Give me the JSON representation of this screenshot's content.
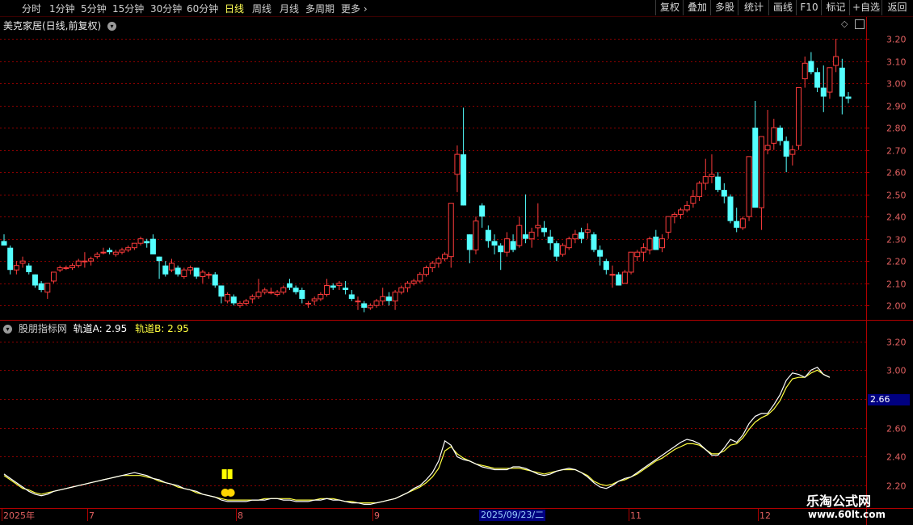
{
  "toolbar": {
    "periods": [
      "分时",
      "1分钟",
      "5分钟",
      "15分钟",
      "30分钟",
      "60分钟",
      "日线",
      "周线",
      "月线",
      "多周期",
      "更多"
    ],
    "active_period": "日线",
    "right_buttons": [
      "复权",
      "叠加",
      "多股",
      "统计",
      "画线",
      "F10",
      "标记",
      "+自选",
      "返回"
    ]
  },
  "main_panel": {
    "title": "美克家居(日线,前复权)",
    "icons": [
      "chevron-down-icon",
      "diamond-icon",
      "panel-toggle-icon"
    ]
  },
  "indicator_panel": {
    "title": "股朋指标网",
    "line_a_label": "轨道A",
    "line_a_value": "2.95",
    "line_b_label": "轨道B",
    "line_b_value": "2.95",
    "colors": {
      "line_a": "#ffffff",
      "line_b": "#ffff40"
    }
  },
  "price_axis": [
    "3.20",
    "3.10",
    "3.00",
    "2.90",
    "2.80",
    "2.70",
    "2.60",
    "2.50",
    "2.40",
    "2.30",
    "2.20",
    "2.10",
    "2.00"
  ],
  "indicator_axis": [
    "3.20",
    "3.00",
    "2.80",
    "2.60",
    "2.40",
    "2.20"
  ],
  "crosshair_price": "2.66",
  "date_axis": [
    "2025年",
    "7",
    "8",
    "9",
    "2025/09/23/二",
    "11",
    "12"
  ],
  "watermark": {
    "line1": "乐淘公式网",
    "line2": "www.60lt.com"
  },
  "colors": {
    "up": "#ff3c3c",
    "down": "#54ffff",
    "grid": "#8b0000",
    "axis_text": "#e06060"
  },
  "chart_data": {
    "type": "candlestick",
    "ylim": [
      1.95,
      3.24
    ],
    "indicator_ylim": [
      2.05,
      3.27
    ],
    "candles": [
      [
        2.29,
        2.32,
        2.27,
        2.27
      ],
      [
        2.26,
        2.27,
        2.14,
        2.16
      ],
      [
        2.16,
        2.2,
        2.14,
        2.18
      ],
      [
        2.19,
        2.22,
        2.17,
        2.2
      ],
      [
        2.18,
        2.19,
        2.14,
        2.15
      ],
      [
        2.14,
        2.14,
        2.08,
        2.09
      ],
      [
        2.1,
        2.11,
        2.06,
        2.07
      ],
      [
        2.06,
        2.1,
        2.03,
        2.1
      ],
      [
        2.11,
        2.15,
        2.1,
        2.15
      ],
      [
        2.16,
        2.18,
        2.15,
        2.17
      ],
      [
        2.17,
        2.18,
        2.16,
        2.17
      ],
      [
        2.17,
        2.19,
        2.16,
        2.18
      ],
      [
        2.18,
        2.21,
        2.17,
        2.2
      ],
      [
        2.2,
        2.24,
        2.17,
        2.2
      ],
      [
        2.2,
        2.22,
        2.18,
        2.21
      ],
      [
        2.22,
        2.24,
        2.21,
        2.23
      ],
      [
        2.24,
        2.26,
        2.23,
        2.24
      ],
      [
        2.25,
        2.26,
        2.23,
        2.24
      ],
      [
        2.23,
        2.25,
        2.22,
        2.24
      ],
      [
        2.24,
        2.26,
        2.23,
        2.25
      ],
      [
        2.25,
        2.27,
        2.24,
        2.26
      ],
      [
        2.26,
        2.28,
        2.25,
        2.28
      ],
      [
        2.28,
        2.31,
        2.27,
        2.3
      ],
      [
        2.29,
        2.3,
        2.26,
        2.28
      ],
      [
        2.3,
        2.32,
        2.24,
        2.23
      ],
      [
        2.22,
        2.22,
        2.12,
        2.2
      ],
      [
        2.18,
        2.2,
        2.13,
        2.14
      ],
      [
        2.16,
        2.21,
        2.15,
        2.19
      ],
      [
        2.17,
        2.18,
        2.13,
        2.14
      ],
      [
        2.13,
        2.17,
        2.12,
        2.16
      ],
      [
        2.16,
        2.18,
        2.14,
        2.17
      ],
      [
        2.17,
        2.17,
        2.12,
        2.13
      ],
      [
        2.13,
        2.16,
        2.1,
        2.15
      ],
      [
        2.14,
        2.15,
        2.12,
        2.14
      ],
      [
        2.14,
        2.15,
        2.08,
        2.09
      ],
      [
        2.09,
        2.09,
        2.01,
        2.04
      ],
      [
        2.02,
        2.06,
        2.01,
        2.05
      ],
      [
        2.04,
        2.05,
        2.0,
        2.01
      ],
      [
        2.0,
        2.02,
        1.99,
        2.01
      ],
      [
        2.01,
        2.03,
        2.0,
        2.02
      ],
      [
        2.03,
        2.05,
        2.01,
        2.04
      ],
      [
        2.04,
        2.12,
        2.03,
        2.06
      ],
      [
        2.06,
        2.08,
        2.05,
        2.07
      ],
      [
        2.06,
        2.08,
        2.05,
        2.06
      ],
      [
        2.05,
        2.07,
        2.04,
        2.06
      ],
      [
        2.06,
        2.09,
        2.05,
        2.08
      ],
      [
        2.1,
        2.12,
        2.07,
        2.08
      ],
      [
        2.08,
        2.09,
        2.05,
        2.06
      ],
      [
        2.07,
        2.08,
        2.01,
        2.03
      ],
      [
        2.01,
        2.02,
        1.99,
        2.01
      ],
      [
        2.02,
        2.04,
        2.0,
        2.03
      ],
      [
        2.03,
        2.06,
        2.02,
        2.05
      ],
      [
        2.05,
        2.12,
        2.04,
        2.09
      ],
      [
        2.09,
        2.1,
        2.07,
        2.08
      ],
      [
        2.09,
        2.11,
        2.07,
        2.1
      ],
      [
        2.08,
        2.11,
        2.05,
        2.07
      ],
      [
        2.05,
        2.07,
        2.02,
        2.03
      ],
      [
        2.02,
        2.04,
        1.98,
        2.02
      ],
      [
        2.01,
        2.02,
        1.97,
        1.99
      ],
      [
        1.99,
        2.01,
        1.98,
        2.0
      ],
      [
        2.0,
        2.03,
        1.99,
        2.02
      ],
      [
        2.02,
        2.08,
        2.0,
        2.04
      ],
      [
        2.04,
        2.06,
        2.0,
        2.02
      ],
      [
        2.02,
        2.07,
        1.98,
        2.06
      ],
      [
        2.06,
        2.09,
        2.05,
        2.08
      ],
      [
        2.08,
        2.11,
        2.06,
        2.1
      ],
      [
        2.1,
        2.12,
        2.09,
        2.11
      ],
      [
        2.11,
        2.15,
        2.1,
        2.14
      ],
      [
        2.14,
        2.18,
        2.13,
        2.17
      ],
      [
        2.17,
        2.2,
        2.15,
        2.19
      ],
      [
        2.19,
        2.22,
        2.17,
        2.21
      ],
      [
        2.21,
        2.24,
        2.2,
        2.23
      ],
      [
        2.22,
        2.46,
        2.17,
        2.46
      ],
      [
        2.59,
        2.72,
        2.51,
        2.68
      ],
      [
        2.68,
        2.89,
        2.45,
        2.45
      ],
      [
        2.32,
        2.32,
        2.19,
        2.25
      ],
      [
        2.25,
        2.4,
        2.23,
        2.38
      ],
      [
        2.45,
        2.46,
        2.35,
        2.4
      ],
      [
        2.34,
        2.36,
        2.26,
        2.29
      ],
      [
        2.29,
        2.32,
        2.23,
        2.27
      ],
      [
        2.27,
        2.28,
        2.16,
        2.24
      ],
      [
        2.24,
        2.33,
        2.22,
        2.3
      ],
      [
        2.29,
        2.32,
        2.24,
        2.25
      ],
      [
        2.27,
        2.4,
        2.26,
        2.36
      ],
      [
        2.32,
        2.5,
        2.28,
        2.3
      ],
      [
        2.3,
        2.35,
        2.26,
        2.33
      ],
      [
        2.35,
        2.46,
        2.31,
        2.36
      ],
      [
        2.35,
        2.38,
        2.31,
        2.33
      ],
      [
        2.31,
        2.34,
        2.25,
        2.28
      ],
      [
        2.28,
        2.29,
        2.2,
        2.22
      ],
      [
        2.23,
        2.28,
        2.22,
        2.27
      ],
      [
        2.26,
        2.31,
        2.25,
        2.3
      ],
      [
        2.3,
        2.34,
        2.28,
        2.32
      ],
      [
        2.33,
        2.35,
        2.28,
        2.3
      ],
      [
        2.33,
        2.37,
        2.3,
        2.34
      ],
      [
        2.32,
        2.33,
        2.24,
        2.25
      ],
      [
        2.25,
        2.27,
        2.18,
        2.22
      ],
      [
        2.2,
        2.21,
        2.14,
        2.16
      ],
      [
        2.14,
        2.18,
        2.08,
        2.14
      ],
      [
        2.14,
        2.15,
        2.09,
        2.09
      ],
      [
        2.1,
        2.16,
        2.1,
        2.15
      ],
      [
        2.15,
        2.24,
        2.14,
        2.24
      ],
      [
        2.22,
        2.25,
        2.2,
        2.24
      ],
      [
        2.24,
        2.28,
        2.2,
        2.26
      ],
      [
        2.25,
        2.31,
        2.23,
        2.3
      ],
      [
        2.31,
        2.34,
        2.25,
        2.25
      ],
      [
        2.26,
        2.32,
        2.24,
        2.3
      ],
      [
        2.33,
        2.4,
        2.3,
        2.4
      ],
      [
        2.4,
        2.42,
        2.37,
        2.41
      ],
      [
        2.41,
        2.44,
        2.39,
        2.43
      ],
      [
        2.43,
        2.47,
        2.42,
        2.45
      ],
      [
        2.46,
        2.52,
        2.44,
        2.49
      ],
      [
        2.49,
        2.56,
        2.47,
        2.55
      ],
      [
        2.55,
        2.66,
        2.52,
        2.58
      ],
      [
        2.58,
        2.68,
        2.55,
        2.59
      ],
      [
        2.58,
        2.6,
        2.51,
        2.52
      ],
      [
        2.52,
        2.55,
        2.46,
        2.49
      ],
      [
        2.49,
        2.5,
        2.37,
        2.38
      ],
      [
        2.38,
        2.44,
        2.33,
        2.35
      ],
      [
        2.35,
        2.4,
        2.34,
        2.39
      ],
      [
        2.4,
        2.67,
        2.38,
        2.67
      ],
      [
        2.8,
        2.92,
        2.44,
        2.44
      ],
      [
        2.44,
        2.76,
        2.34,
        2.76
      ],
      [
        2.7,
        2.88,
        2.68,
        2.72
      ],
      [
        2.73,
        2.84,
        2.7,
        2.8
      ],
      [
        2.8,
        2.81,
        2.72,
        2.74
      ],
      [
        2.74,
        2.76,
        2.6,
        2.67
      ],
      [
        2.68,
        2.72,
        2.63,
        2.7
      ],
      [
        2.72,
        2.9,
        2.7,
        2.98
      ],
      [
        3.02,
        3.12,
        2.98,
        3.09
      ],
      [
        3.1,
        3.14,
        3.04,
        3.05
      ],
      [
        3.05,
        3.07,
        2.96,
        2.98
      ],
      [
        2.98,
        3.08,
        2.87,
        2.94
      ],
      [
        2.96,
        3.04,
        2.93,
        3.07
      ],
      [
        3.08,
        3.2,
        3.05,
        3.12
      ],
      [
        3.07,
        3.11,
        2.86,
        2.94
      ],
      [
        2.94,
        2.96,
        2.91,
        2.93
      ]
    ],
    "rail_a": [
      2.28,
      2.25,
      2.22,
      2.19,
      2.16,
      2.14,
      2.13,
      2.14,
      2.16,
      2.17,
      2.18,
      2.19,
      2.2,
      2.21,
      2.22,
      2.23,
      2.24,
      2.25,
      2.26,
      2.27,
      2.28,
      2.29,
      2.28,
      2.27,
      2.25,
      2.24,
      2.22,
      2.21,
      2.2,
      2.18,
      2.17,
      2.16,
      2.14,
      2.13,
      2.12,
      2.1,
      2.09,
      2.09,
      2.09,
      2.09,
      2.1,
      2.1,
      2.1,
      2.11,
      2.11,
      2.1,
      2.1,
      2.09,
      2.09,
      2.09,
      2.1,
      2.1,
      2.11,
      2.1,
      2.1,
      2.09,
      2.08,
      2.08,
      2.07,
      2.07,
      2.08,
      2.09,
      2.1,
      2.11,
      2.13,
      2.15,
      2.18,
      2.2,
      2.24,
      2.29,
      2.37,
      2.51,
      2.48,
      2.4,
      2.38,
      2.37,
      2.35,
      2.33,
      2.32,
      2.31,
      2.31,
      2.31,
      2.33,
      2.33,
      2.32,
      2.3,
      2.28,
      2.27,
      2.28,
      2.3,
      2.31,
      2.32,
      2.31,
      2.29,
      2.26,
      2.22,
      2.19,
      2.18,
      2.2,
      2.23,
      2.25,
      2.26,
      2.29,
      2.32,
      2.35,
      2.38,
      2.41,
      2.44,
      2.47,
      2.5,
      2.52,
      2.51,
      2.49,
      2.45,
      2.41,
      2.41,
      2.46,
      2.52,
      2.5,
      2.55,
      2.63,
      2.68,
      2.7,
      2.7,
      2.76,
      2.83,
      2.93,
      2.98,
      2.97,
      2.95,
      3.0,
      3.02,
      2.97,
      2.95
    ],
    "rail_b": [
      2.27,
      2.24,
      2.21,
      2.18,
      2.17,
      2.15,
      2.14,
      2.15,
      2.16,
      2.17,
      2.18,
      2.19,
      2.2,
      2.21,
      2.22,
      2.23,
      2.24,
      2.25,
      2.26,
      2.27,
      2.27,
      2.27,
      2.27,
      2.26,
      2.25,
      2.23,
      2.22,
      2.21,
      2.19,
      2.18,
      2.17,
      2.15,
      2.14,
      2.13,
      2.12,
      2.11,
      2.1,
      2.1,
      2.1,
      2.1,
      2.1,
      2.1,
      2.11,
      2.11,
      2.11,
      2.11,
      2.11,
      2.1,
      2.1,
      2.1,
      2.1,
      2.11,
      2.11,
      2.11,
      2.1,
      2.09,
      2.09,
      2.08,
      2.08,
      2.08,
      2.08,
      2.09,
      2.1,
      2.11,
      2.13,
      2.15,
      2.17,
      2.19,
      2.22,
      2.26,
      2.32,
      2.44,
      2.47,
      2.42,
      2.39,
      2.37,
      2.35,
      2.34,
      2.33,
      2.32,
      2.32,
      2.32,
      2.32,
      2.32,
      2.31,
      2.3,
      2.29,
      2.28,
      2.29,
      2.3,
      2.31,
      2.31,
      2.31,
      2.29,
      2.27,
      2.23,
      2.21,
      2.2,
      2.21,
      2.23,
      2.24,
      2.26,
      2.28,
      2.31,
      2.34,
      2.37,
      2.39,
      2.42,
      2.45,
      2.47,
      2.49,
      2.49,
      2.48,
      2.45,
      2.42,
      2.42,
      2.44,
      2.48,
      2.49,
      2.53,
      2.59,
      2.64,
      2.67,
      2.69,
      2.73,
      2.79,
      2.88,
      2.94,
      2.95,
      2.95,
      2.98,
      3.0,
      2.97,
      2.95
    ],
    "signal_index": 36
  }
}
